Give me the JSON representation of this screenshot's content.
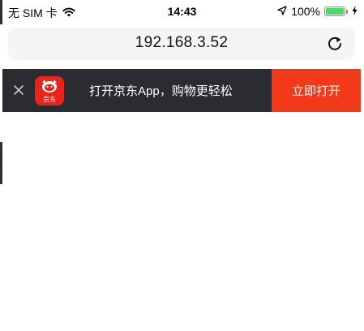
{
  "status_bar": {
    "carrier": "无 SIM 卡",
    "time": "14:43",
    "battery_percent": "100%",
    "battery_level": 1.0,
    "icons": [
      "wifi-icon",
      "location-arrow-icon",
      "battery-icon",
      "charging-bolt-icon"
    ]
  },
  "address_bar": {
    "url": "192.168.3.52",
    "reload_icon": "reload-icon"
  },
  "app_banner": {
    "message": "打开京东App，购物更轻松",
    "open_button": "立即打开",
    "logo_text": "京东",
    "close_icon": "close-icon",
    "colors": {
      "background": "#2b2c31",
      "button": "#f23a1a",
      "logo": "#e8231a"
    }
  }
}
